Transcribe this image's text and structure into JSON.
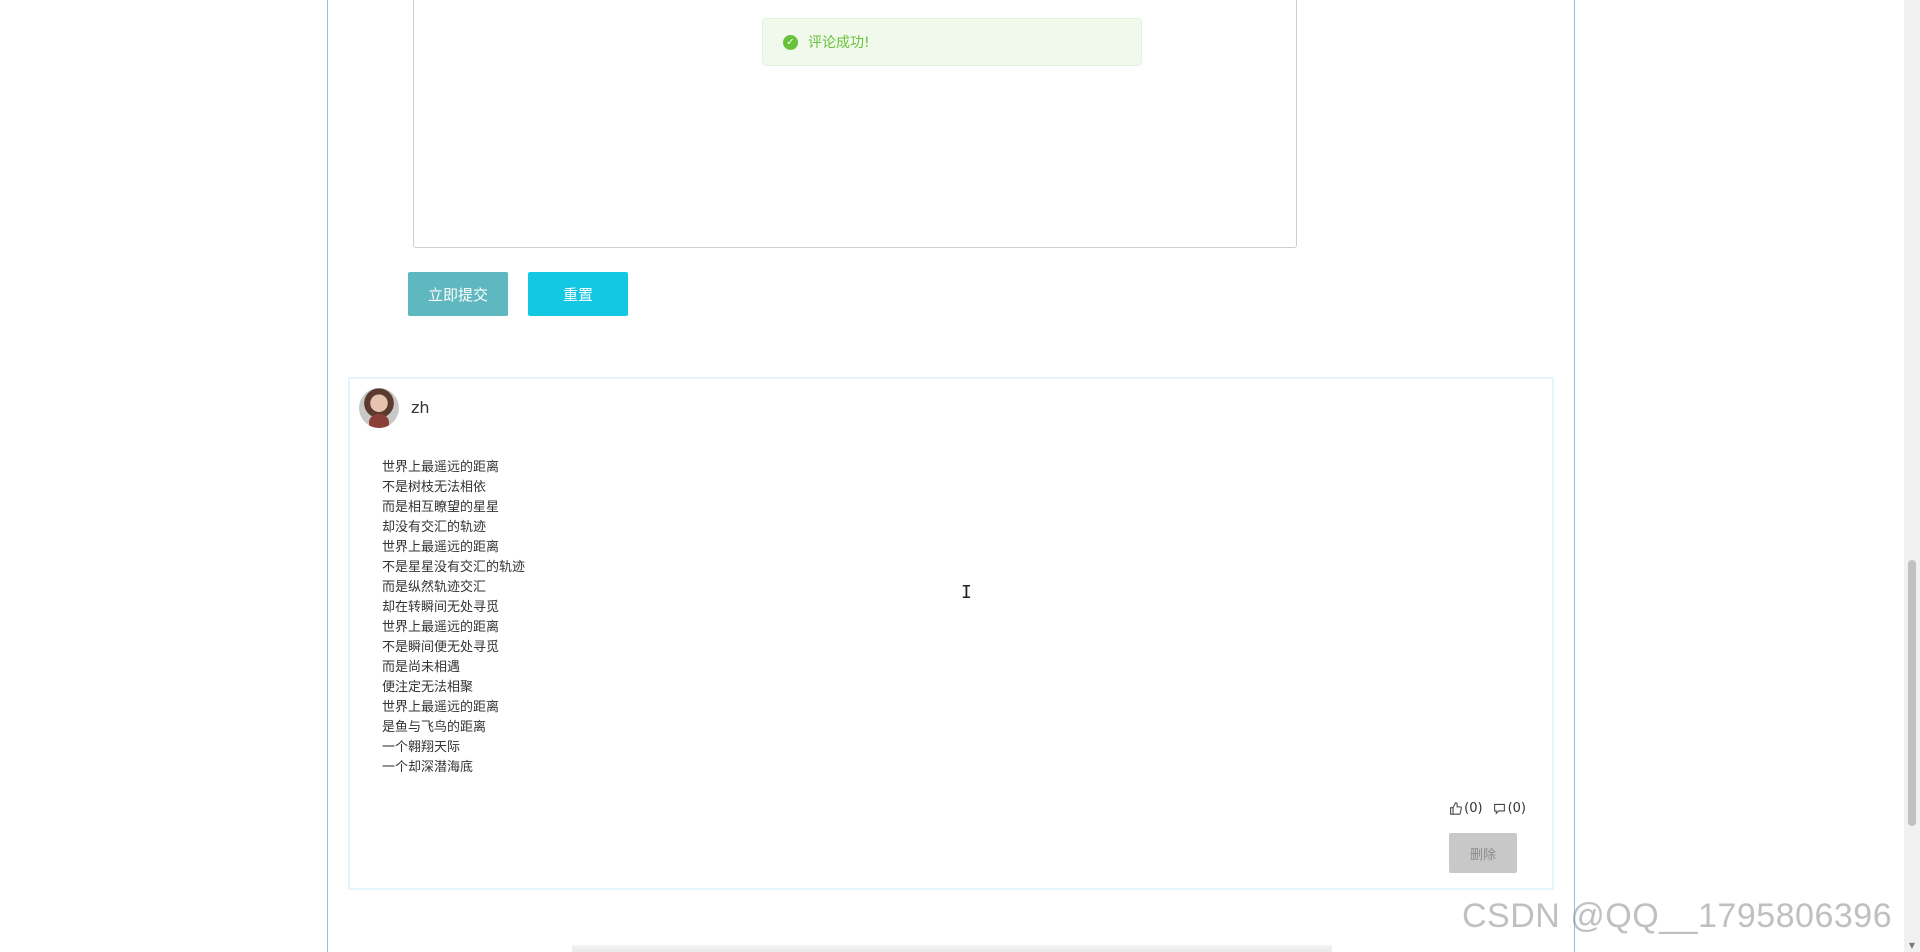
{
  "toast": {
    "message": "评论成功!",
    "icon": "check-circle-icon",
    "color": "#67c23a"
  },
  "form": {
    "submit_label": "立即提交",
    "reset_label": "重置"
  },
  "comment": {
    "username": "zh",
    "lines": [
      "世界上最遥远的距离",
      "不是树枝无法相依",
      "而是相互瞭望的星星",
      "却没有交汇的轨迹",
      "世界上最遥远的距离",
      "不是星星没有交汇的轨迹",
      "而是纵然轨迹交汇",
      "却在转瞬间无处寻觅",
      "世界上最遥远的距离",
      "不是瞬间便无处寻觅",
      "而是尚未相遇",
      "便注定无法相聚",
      "世界上最遥远的距离",
      "是鱼与飞鸟的距离",
      "一个翱翔天际",
      "一个却深潜海底"
    ],
    "like_count": "(0)",
    "dislike_count": "(0)",
    "delete_label": "删除"
  },
  "watermark": "CSDN @QQ__1795806396"
}
